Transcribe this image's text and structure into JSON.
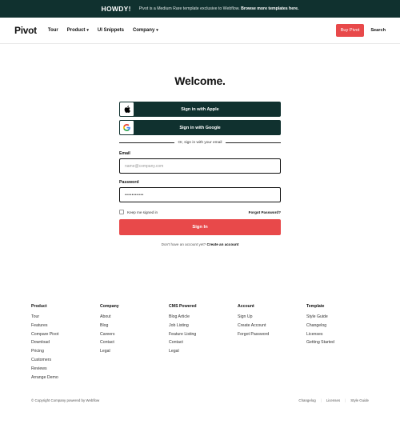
{
  "banner": {
    "badge": "HOWDY!",
    "text": "Pivot is a Medium Rare template exclusive to Webflow.",
    "link": "Browse more templates here."
  },
  "nav": {
    "logo": "Pivot",
    "links": [
      {
        "label": "Tour",
        "dropdown": false
      },
      {
        "label": "Product",
        "dropdown": true
      },
      {
        "label": "UI Snippets",
        "dropdown": false
      },
      {
        "label": "Company",
        "dropdown": true
      }
    ],
    "buy_label": "Buy Pivot",
    "search_label": "Search"
  },
  "page": {
    "title": "Welcome."
  },
  "form": {
    "apple_label": "Sign in with Apple",
    "google_label": "Sign in with Google",
    "divider_text": "Or, sign in with your email",
    "email_label": "Email",
    "email_placeholder": "name@company.com",
    "password_label": "Password",
    "password_value": "•••••••••••",
    "keep_signed_in": "Keep me signed in",
    "forgot_password": "Forgot Password?",
    "signin_label": "Sign In",
    "no_account_text": "Don't have an account yet?",
    "create_account": "Create an account"
  },
  "footer": {
    "columns": [
      {
        "title": "Product",
        "links": [
          "Tour",
          "Features",
          "Compare Pivot",
          "Download",
          "Pricing",
          "Customers",
          "Reviews",
          "Arrange Demo"
        ]
      },
      {
        "title": "Company",
        "links": [
          "About",
          "Blog",
          "Careers",
          "Contact",
          "Legal"
        ]
      },
      {
        "title": "CMS Powered",
        "links": [
          "Blog Article",
          "Job Listing",
          "Feature Listing",
          "Contact",
          "Legal"
        ]
      },
      {
        "title": "Account",
        "links": [
          "Sign Up",
          "Create Account",
          "Forgot Password"
        ]
      },
      {
        "title": "Template",
        "links": [
          "Style Guide",
          "Changelog",
          "Licenses",
          "Getting Started"
        ]
      }
    ],
    "copyright": "© Copyright Company powered by Webflow",
    "bottom_links": [
      "Changelog",
      "Licenses",
      "Style Guide"
    ]
  },
  "colors": {
    "dark_green": "#10312f",
    "accent_red": "#e8494a"
  },
  "icons": {
    "apple": "apple-icon",
    "google": "google-icon",
    "caret": "chevron-down-icon"
  }
}
